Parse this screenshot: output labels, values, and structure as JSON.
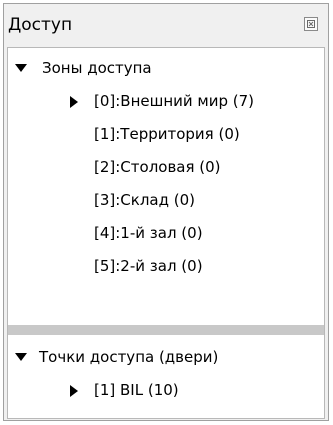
{
  "panel": {
    "title": "Доступ",
    "close_icon": "close-icon"
  },
  "zones": {
    "header_label": "Зоны доступа",
    "expanded": true,
    "items": [
      {
        "label": "[0]:Внешний мир (7)",
        "has_children": true
      },
      {
        "label": "[1]:Территория (0)",
        "has_children": false
      },
      {
        "label": "[2]:Столовая (0)",
        "has_children": false
      },
      {
        "label": "[3]:Склад (0)",
        "has_children": false
      },
      {
        "label": "[4]:1-й зал (0)",
        "has_children": false
      },
      {
        "label": "[5]:2-й зал (0)",
        "has_children": false
      }
    ]
  },
  "access_points": {
    "header_label": "Точки доступа (двери)",
    "expanded": true,
    "items": [
      {
        "label": "[1] BIL (10)",
        "has_children": true
      }
    ]
  }
}
